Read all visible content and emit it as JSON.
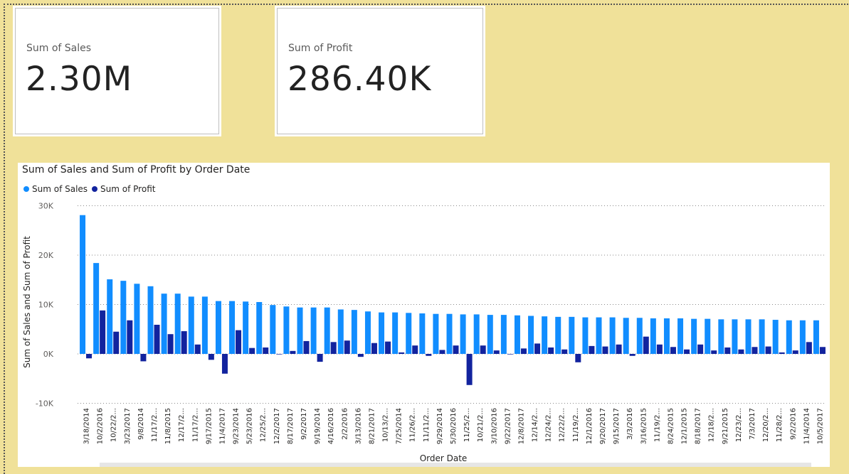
{
  "cards": [
    {
      "label": "Sum of Sales",
      "value": "2.30M"
    },
    {
      "label": "Sum of Profit",
      "value": "286.40K"
    }
  ],
  "colors": {
    "background": "#f0e199",
    "sales": "#118dff",
    "profit": "#12239e"
  },
  "chart_data": {
    "type": "bar",
    "title": "Sum of Sales and Sum of Profit by Order Date",
    "xlabel": "Order Date",
    "ylabel": "Sum of Sales and Sum of Profit",
    "ylim": [
      -10000,
      30000
    ],
    "yticks": [
      -10000,
      0,
      10000,
      20000,
      30000
    ],
    "ytick_labels": [
      "-10K",
      "0K",
      "10K",
      "20K",
      "30K"
    ],
    "grid": true,
    "legend": "top-left",
    "categories": [
      "3/18/2014",
      "10/2/2016",
      "10/22/2...",
      "3/23/2017",
      "9/8/2014",
      "11/17/2...",
      "11/8/2015",
      "12/17/2...",
      "11/17/2...",
      "9/17/2015",
      "11/4/2017",
      "9/23/2014",
      "5/23/2016",
      "12/25/2...",
      "12/2/2017",
      "8/17/2017",
      "9/2/2017",
      "9/19/2014",
      "4/16/2016",
      "2/2/2016",
      "3/13/2016",
      "8/21/2017",
      "10/13/2...",
      "7/25/2014",
      "11/26/2...",
      "11/11/2...",
      "9/29/2014",
      "5/30/2016",
      "11/25/2...",
      "10/21/2...",
      "3/10/2016",
      "9/22/2017",
      "12/8/2017",
      "12/14/2...",
      "12/24/2...",
      "12/22/2...",
      "11/19/2...",
      "12/1/2016",
      "9/20/2017",
      "9/15/2017",
      "3/3/2016",
      "3/16/2015",
      "11/19/2...",
      "8/24/2015",
      "12/1/2015",
      "8/18/2017",
      "12/18/2...",
      "9/21/2015",
      "12/23/2...",
      "7/3/2017",
      "12/20/2...",
      "11/28/2...",
      "9/2/2016",
      "11/4/2014",
      "10/5/2017"
    ],
    "series": [
      {
        "name": "Sum of Sales",
        "values": [
          28100,
          18400,
          15100,
          14800,
          14200,
          13700,
          12200,
          12200,
          11600,
          11600,
          10700,
          10700,
          10600,
          10500,
          9900,
          9600,
          9400,
          9400,
          9400,
          9000,
          8900,
          8600,
          8400,
          8400,
          8300,
          8200,
          8100,
          8100,
          8000,
          8000,
          7900,
          7900,
          7800,
          7700,
          7600,
          7500,
          7500,
          7400,
          7400,
          7400,
          7300,
          7300,
          7200,
          7200,
          7200,
          7100,
          7100,
          7000,
          7000,
          7000,
          7000,
          6900,
          6800,
          6800,
          6800
        ]
      },
      {
        "name": "Sum of Profit",
        "values": [
          -900,
          8800,
          4500,
          6800,
          -1500,
          5900,
          4000,
          4600,
          1900,
          -1200,
          -4000,
          4800,
          1200,
          1300,
          -100,
          600,
          2600,
          -1600,
          2400,
          2700,
          -600,
          2200,
          2500,
          300,
          1700,
          -400,
          800,
          1700,
          -6300,
          1700,
          700,
          -100,
          1100,
          2100,
          1300,
          900,
          -1700,
          1600,
          1500,
          1900,
          -400,
          3500,
          1900,
          1400,
          900,
          1900,
          700,
          1300,
          900,
          1400,
          1500,
          300,
          700,
          2400,
          1400
        ]
      }
    ]
  }
}
